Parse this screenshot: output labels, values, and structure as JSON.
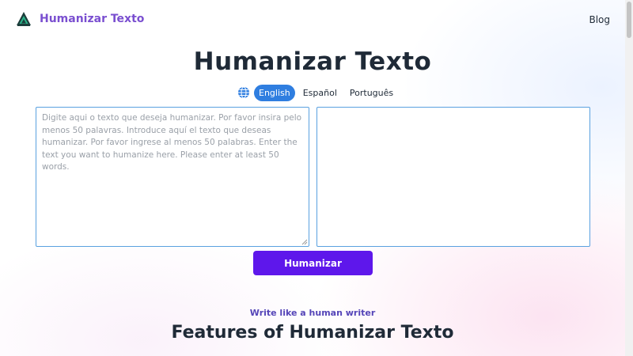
{
  "header": {
    "brand_name": "Humanizar Texto",
    "nav": {
      "blog_label": "Blog"
    }
  },
  "main": {
    "title": "Humanizar Texto",
    "languages": {
      "icon": "globe-icon",
      "options": [
        {
          "label": "English",
          "active": true
        },
        {
          "label": "Español",
          "active": false
        },
        {
          "label": "Português",
          "active": false
        }
      ]
    },
    "input": {
      "value": "",
      "placeholder": "Digite aqui o texto que deseja humanizar. Por favor insira pelo menos 50 palavras. Introduce aquí el texto que deseas humanizar. Por favor ingrese al menos 50 palabras. Enter the text you want to humanize here. Please enter at least 50 words."
    },
    "output": {
      "value": ""
    },
    "humanize_button": "Humanizar"
  },
  "features": {
    "tagline": "Write like a human writer",
    "title": "Features of Humanizar Texto"
  },
  "colors": {
    "brand": "#7a4fd0",
    "primary_button": "#5e17eb",
    "active_language": "#2f7ee0",
    "textarea_border": "#5aa1e0",
    "tagline": "#5545b8"
  }
}
